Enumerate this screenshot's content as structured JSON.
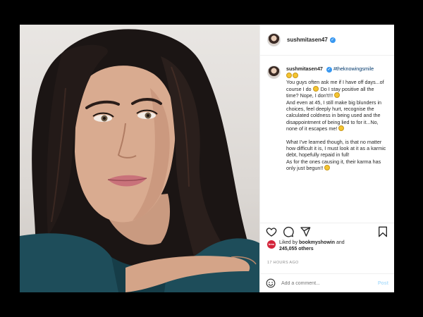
{
  "post": {
    "username": "sushmitasen47",
    "verified_mark": "✓",
    "caption": {
      "username": "sushmitasen47",
      "hashtag": "#theknowingsmile",
      "line1": "You guys often ask me if I have off days...of course I do",
      "line1b": "Do I stay positive all the time? Nope, I don't!!!",
      "line2": "And even at 45, I still make big blunders in choices, feel deeply hurt, recognise the calculated coldness in being used and the disappointment of being lied to for it...No, none of it escapes me!",
      "line3": "What I've learned though, is that no matter how difficult it is, I must look at it as a karmic debt, hopefully repaid in full!",
      "line4": "As for the ones causing it, their karma has only just begun!!"
    },
    "likes": {
      "avatar_text": "bms",
      "prefix": "Liked by",
      "liked_by": "bookmyshowin",
      "and": "and",
      "count": "245,055 others"
    },
    "timestamp": "17 HOURS AGO",
    "comment": {
      "placeholder": "Add a comment...",
      "post_label": "Post"
    }
  },
  "icons": {
    "like": "heart-icon",
    "comment": "comment-icon",
    "share": "share-icon",
    "save": "bookmark-icon",
    "emoji": "emoji-icon"
  },
  "colors": {
    "link": "#00376b",
    "verified": "#3897f0",
    "muted": "#8e8e8e",
    "post_disabled": "#b2dffc"
  }
}
